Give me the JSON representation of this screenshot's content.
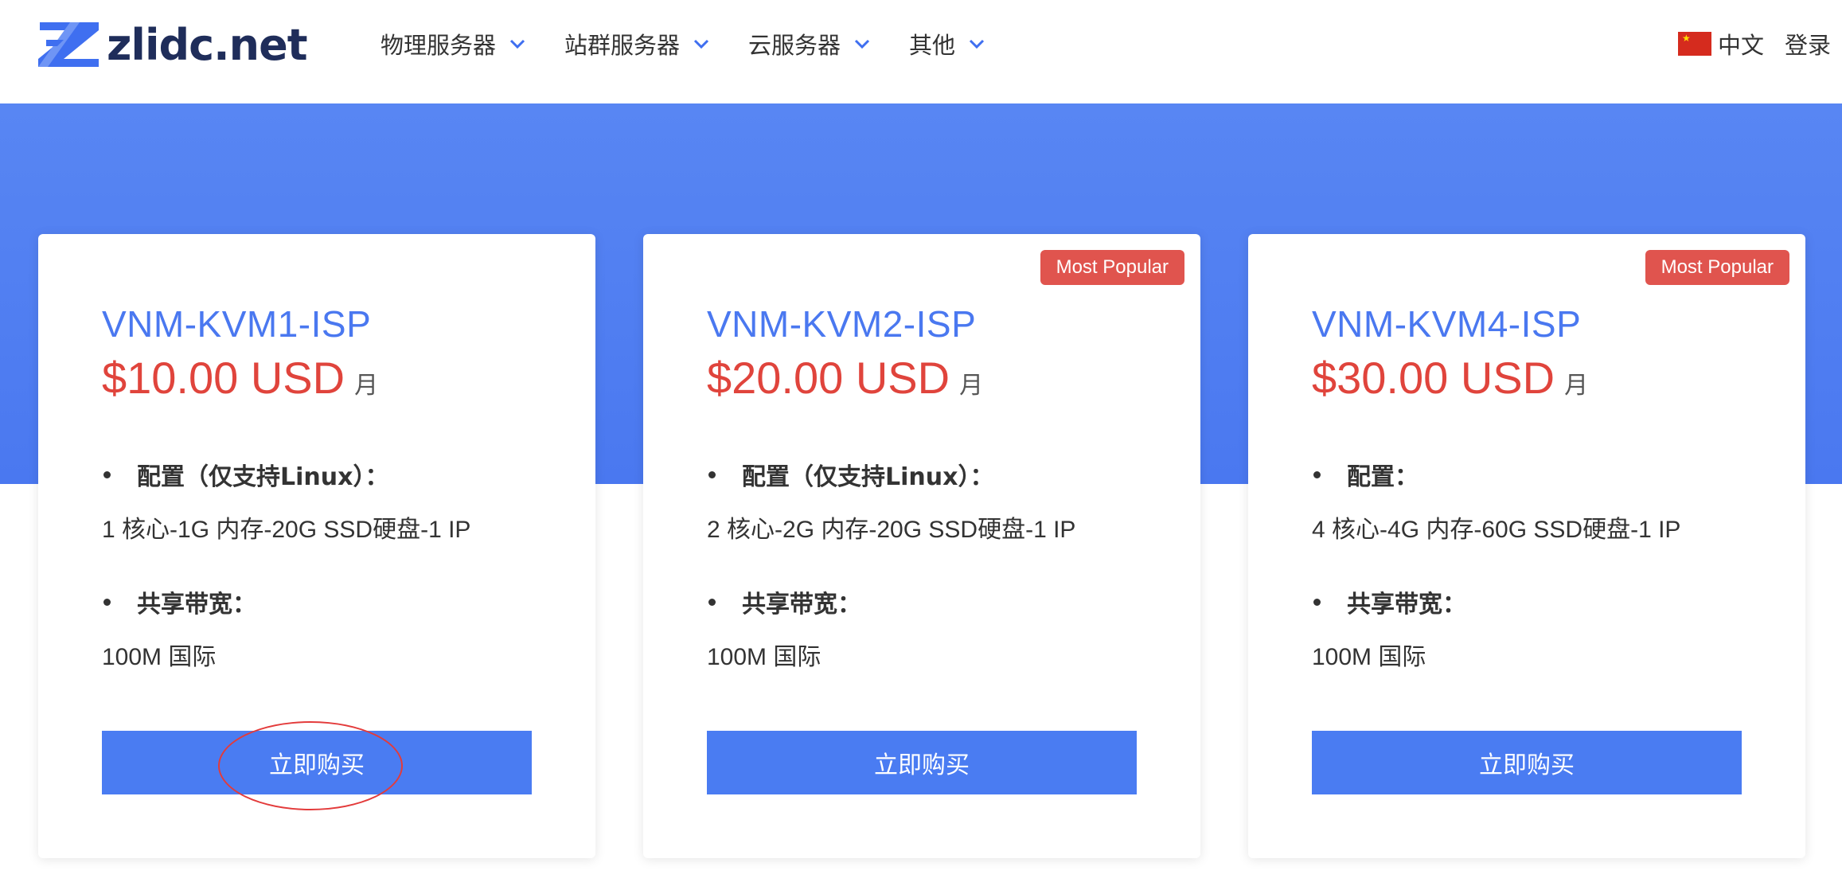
{
  "brand": {
    "logo_text": "zlidc.net",
    "logo_color": "#3f6ff0"
  },
  "nav": {
    "items": [
      {
        "label": "物理服务器"
      },
      {
        "label": "站群服务器"
      },
      {
        "label": "云服务器"
      },
      {
        "label": "其他"
      }
    ],
    "language": "中文",
    "login": "登录"
  },
  "colors": {
    "accent": "#4a78f0",
    "price": "#e0443c",
    "badge": "#e0544e",
    "button": "#4a7cf2"
  },
  "plans": [
    {
      "name": "VNM-KVM1-ISP",
      "price": "$10.00 USD",
      "period": "月",
      "badge": "",
      "config_label": "配置（仅支持Linux）：",
      "config_value": "1 核心-1G 内存-20G SSD硬盘-1 IP",
      "bandwidth_label": "共享带宽：",
      "bandwidth_value": "100M 国际",
      "buy_label": "立即购买"
    },
    {
      "name": "VNM-KVM2-ISP",
      "price": "$20.00 USD",
      "period": "月",
      "badge": "Most Popular",
      "config_label": "配置（仅支持Linux）：",
      "config_value": "2 核心-2G 内存-20G SSD硬盘-1 IP",
      "bandwidth_label": "共享带宽：",
      "bandwidth_value": "100M 国际",
      "buy_label": "立即购买"
    },
    {
      "name": "VNM-KVM4-ISP",
      "price": "$30.00 USD",
      "period": "月",
      "badge": "Most Popular",
      "config_label": "配置：",
      "config_value": "4 核心-4G 内存-60G SSD硬盘-1 IP",
      "bandwidth_label": "共享带宽：",
      "bandwidth_value": "100M 国际",
      "buy_label": "立即购买"
    }
  ]
}
